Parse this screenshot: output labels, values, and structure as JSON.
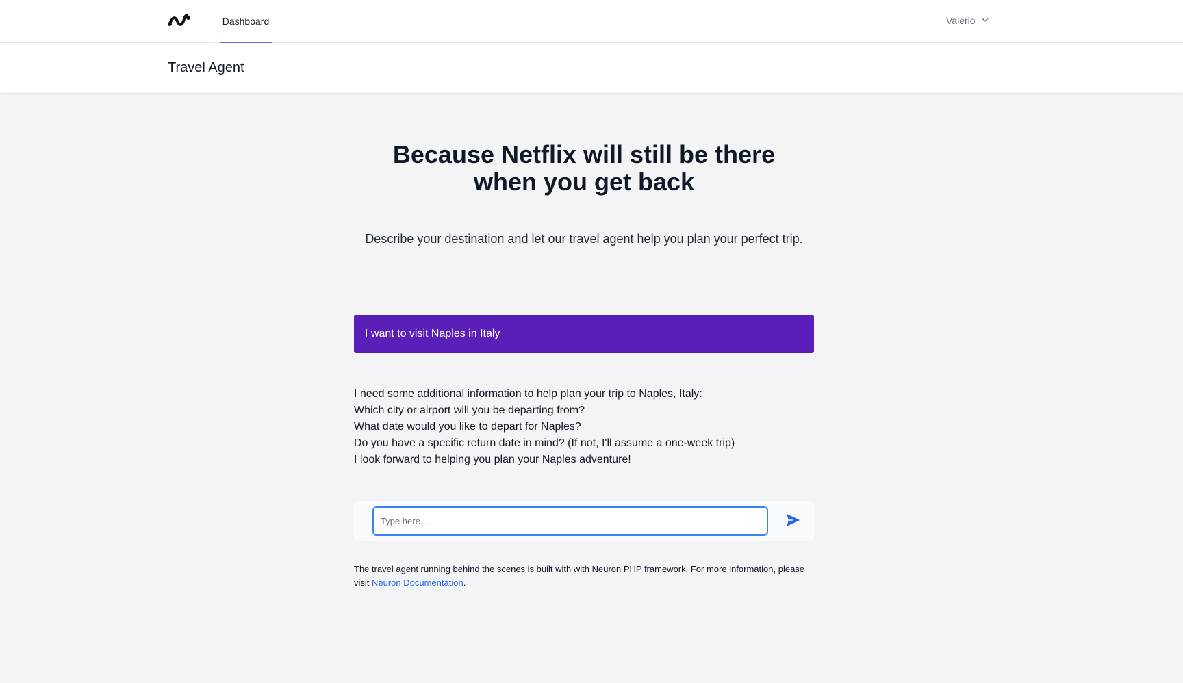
{
  "nav": {
    "logo_icon": "wave-logo-icon",
    "tabs": [
      {
        "label": "Dashboard",
        "active": true
      }
    ],
    "user": {
      "name": "Valerio",
      "icon": "chevron-down-icon"
    }
  },
  "header": {
    "title": "Travel Agent"
  },
  "hero": {
    "title_line1": "Because Netflix will still be there",
    "title_line2": "when you get back",
    "subtitle": "Describe your destination and let our travel agent help you plan your perfect trip."
  },
  "chat": {
    "user_message": "I want to visit Naples in Italy",
    "assistant_lines": [
      "I need some additional information to help plan your trip to Naples, Italy:",
      "Which city or airport will you be departing from?",
      "What date would you like to depart for Naples?",
      "Do you have a specific return date in mind? (If not, I'll assume a one-week trip)",
      "I look forward to helping you plan your Naples adventure!"
    ]
  },
  "composer": {
    "value": "",
    "placeholder": "Type here...",
    "send_icon": "paper-plane-send-icon"
  },
  "footnote": {
    "text_before": "The travel agent running behind the scenes is built with with Neuron PHP framework. For more information, please visit ",
    "link_label": "Neuron Documentation",
    "text_after": "."
  },
  "colors": {
    "accent_indigo": "#6366f1",
    "user_bubble": "#5a1fb8",
    "input_focus": "#3b82f6",
    "send_icon": "#2563eb",
    "link": "#2563eb",
    "page_bg": "#f3f4f6"
  }
}
